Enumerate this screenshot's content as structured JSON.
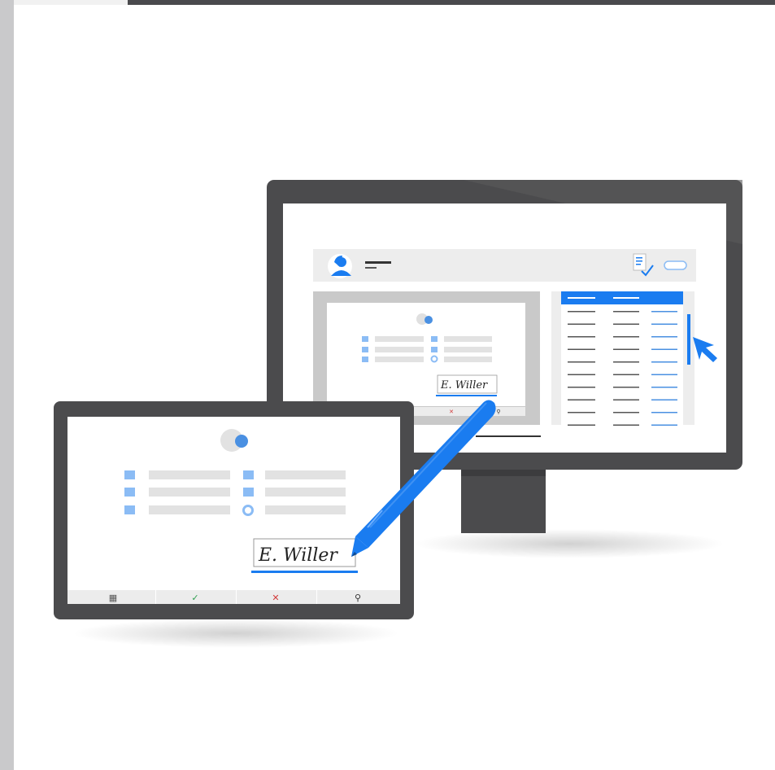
{
  "colors": {
    "accent": "#1a7cf0",
    "accent_light": "#8bbcf5",
    "bezel": "#4b4b4d",
    "screen": "#ffffff",
    "panel": "#ededed",
    "placeholder": "#e2e2e2",
    "rail": "#c9c9cb"
  },
  "monitor_ui": {
    "avatar_icon": "user-avatar-icon",
    "document_icon": "document-check-icon",
    "table_rows": 10,
    "signature_text": "E. Willer"
  },
  "tablet_ui": {
    "signature_text": "E. Willer",
    "toolbar": [
      {
        "icon": "qr-grid-icon",
        "glyph": "▦"
      },
      {
        "icon": "confirm-check-icon",
        "glyph": "✓"
      },
      {
        "icon": "cancel-x-icon",
        "glyph": "✕"
      },
      {
        "icon": "search-icon",
        "glyph": "⚲"
      }
    ]
  },
  "stylus_icon": "stylus-pen-icon",
  "cursor_icon": "mouse-pointer-icon"
}
